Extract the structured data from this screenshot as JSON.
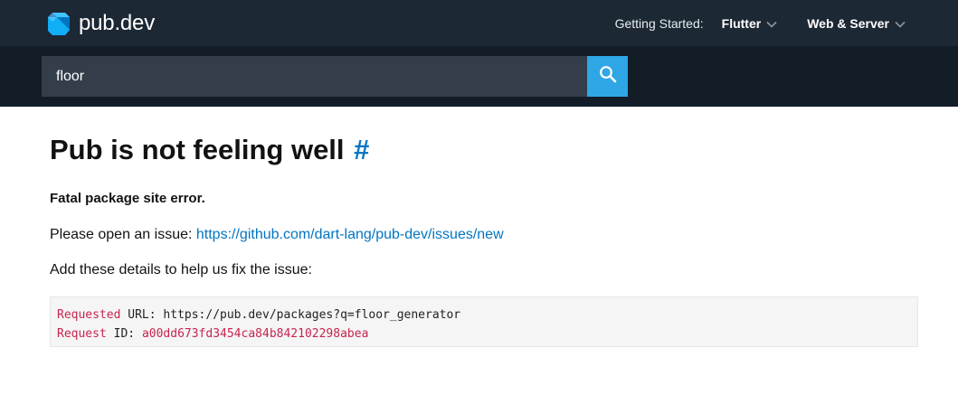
{
  "header": {
    "logo_text": "pub.dev",
    "nav_label": "Getting Started:",
    "nav_items": [
      {
        "label": "Flutter"
      },
      {
        "label": "Web & Server"
      }
    ]
  },
  "search": {
    "value": "floor"
  },
  "main": {
    "title": "Pub is not feeling well",
    "title_anchor": "#",
    "fatal": "Fatal package site error.",
    "issue_prefix": "Please open an issue: ",
    "issue_link": "https://github.com/dart-lang/pub-dev/issues/new",
    "details_text": "Add these details to help us fix the issue:",
    "details": {
      "line1_key": "Requested",
      "line1_rest": " URL: https://pub.dev/packages?q=floor_generator",
      "line2_key": "Request",
      "line2_label": " ID: ",
      "line2_value": "a00dd673fd3454ca84b842102298abea"
    }
  },
  "colors": {
    "header_bg": "#1c2834",
    "searchbar_bg": "#121d28",
    "search_input_bg": "#333e4a",
    "search_button_bg": "#2fa6e6",
    "link": "#0175c2",
    "code_keyword": "#c7254e"
  },
  "icons": {
    "logo": "dart-logo-icon",
    "search": "search-icon",
    "chevron": "chevron-down-icon"
  }
}
